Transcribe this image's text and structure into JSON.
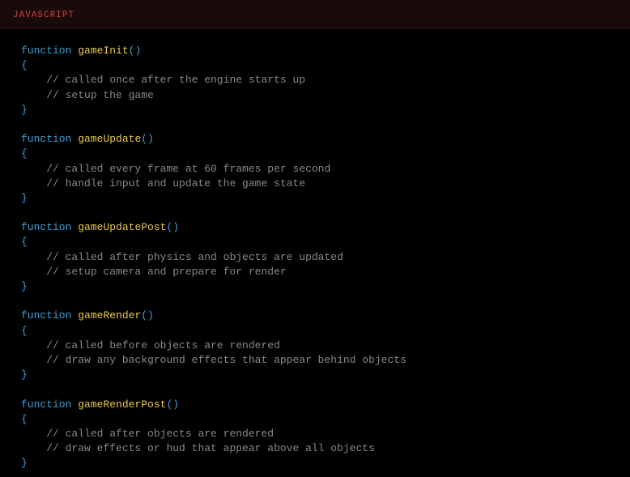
{
  "header": {
    "language": "JAVASCRIPT"
  },
  "code": {
    "keyword_function": "function",
    "empty": "",
    "indent1": "    ",
    "open_brace": "{",
    "close_brace": "}",
    "open_paren": "(",
    "close_paren": ")",
    "functions": [
      {
        "name": "gameInit",
        "comments": [
          "// called once after the engine starts up",
          "// setup the game"
        ]
      },
      {
        "name": "gameUpdate",
        "comments": [
          "// called every frame at 60 frames per second",
          "// handle input and update the game state"
        ]
      },
      {
        "name": "gameUpdatePost",
        "comments": [
          "// called after physics and objects are updated",
          "// setup camera and prepare for render"
        ]
      },
      {
        "name": "gameRender",
        "comments": [
          "// called before objects are rendered",
          "// draw any background effects that appear behind objects"
        ]
      },
      {
        "name": "gameRenderPost",
        "comments": [
          "// called after objects are rendered",
          "// draw effects or hud that appear above all objects"
        ]
      }
    ]
  }
}
